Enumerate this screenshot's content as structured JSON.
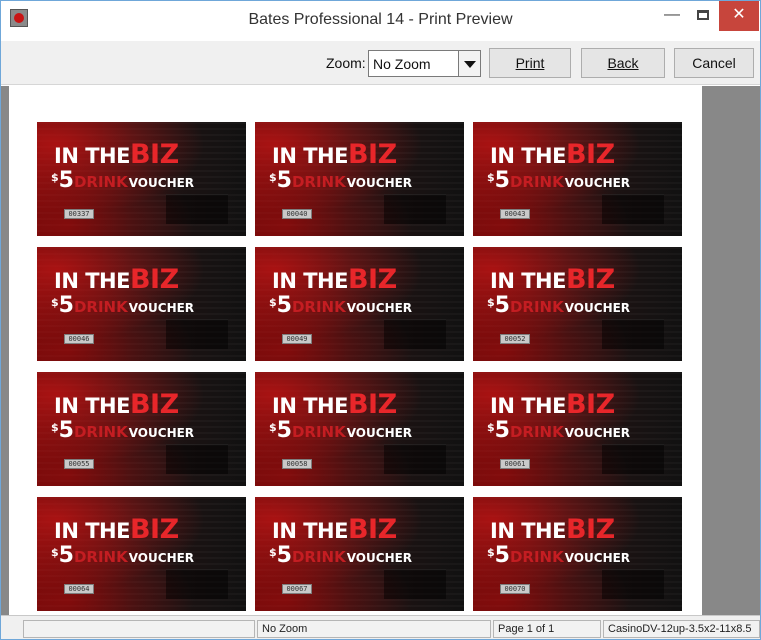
{
  "window": {
    "title": "Bates Professional 14 - Print Preview"
  },
  "toolbar": {
    "zoom_label": "Zoom:",
    "zoom_value": "No Zoom",
    "print_label": "Print",
    "back_label": "Back",
    "cancel_label": "Cancel"
  },
  "ticket": {
    "line1_a": "IN THE",
    "line1_b": "BIZ",
    "dollar": "$",
    "amount": "5",
    "drink": "DRINK",
    "voucher": "VOUCHER"
  },
  "serials": [
    "00337",
    "00040",
    "00043",
    "00046",
    "00049",
    "00052",
    "00055",
    "00058",
    "00061",
    "00064",
    "00067",
    "00070"
  ],
  "status": {
    "cell1": "",
    "zoom": "No Zoom",
    "page": "Page 1 of 1",
    "layout": "CasinoDV-12up-3.5x2-11x8.5"
  },
  "colors": {
    "close_button": "#c7453c",
    "biz_red": "#e8262a",
    "preview_bg": "#888888"
  }
}
